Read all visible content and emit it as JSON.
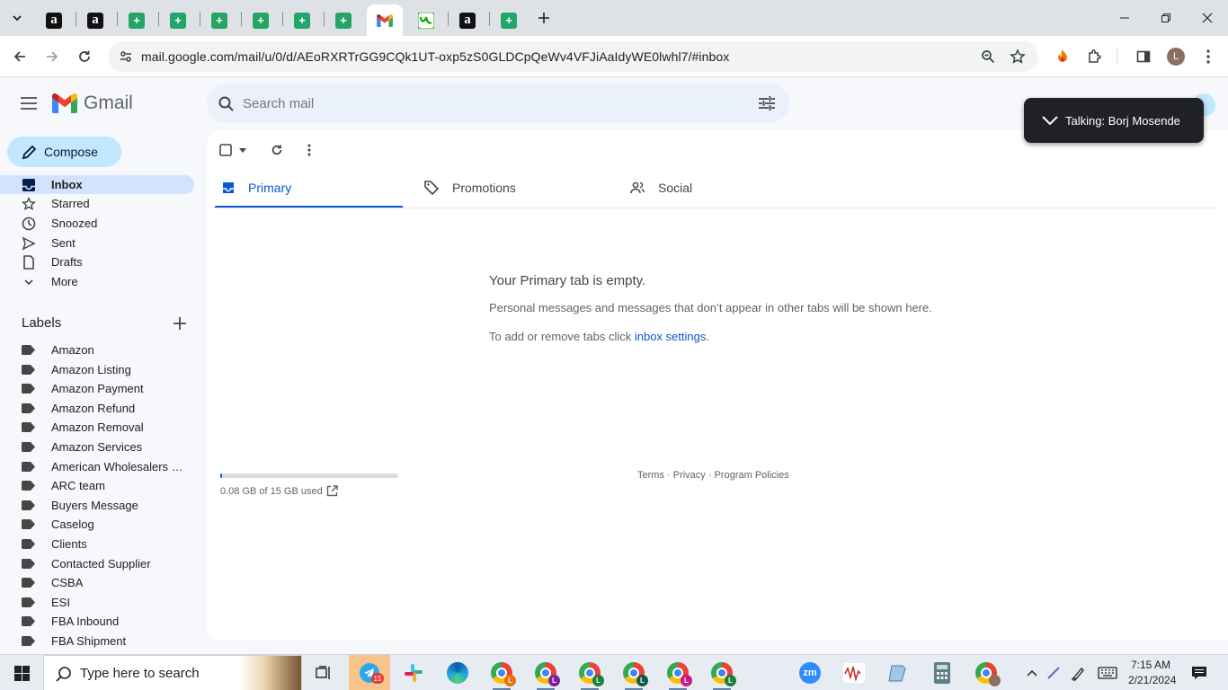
{
  "browser": {
    "tabs": [
      {
        "icon": "amazon-favicon",
        "glyph": "a"
      },
      {
        "icon": "amazon-favicon",
        "glyph": "a"
      },
      {
        "icon": "sheets-favicon",
        "glyph": "+"
      },
      {
        "icon": "sheets-favicon",
        "glyph": "+"
      },
      {
        "icon": "sheets-favicon",
        "glyph": "+"
      },
      {
        "icon": "sheets-favicon",
        "glyph": "+"
      },
      {
        "icon": "sheets-favicon",
        "glyph": "+"
      },
      {
        "icon": "sheets-favicon",
        "glyph": "+"
      },
      {
        "icon": "gmail-favicon",
        "glyph": ""
      },
      {
        "icon": "upwork-favicon",
        "glyph": ""
      },
      {
        "icon": "amazon-favicon",
        "glyph": "a"
      },
      {
        "icon": "sheets-favicon",
        "glyph": "+"
      }
    ],
    "active_tab_index": 8,
    "url": "mail.google.com/mail/u/0/d/AEoRXRTrGG9CQk1UT-oxp5zS0GLDCpQeWv4VFJiAaIdyWE0lwhl7/#inbox",
    "profile_initial": "L"
  },
  "gmail": {
    "logo_text": "Gmail",
    "search_placeholder": "Search mail",
    "compose_label": "Compose",
    "nav": [
      {
        "label": "Inbox",
        "icon": "inbox-icon",
        "active": true
      },
      {
        "label": "Starred",
        "icon": "star-icon"
      },
      {
        "label": "Snoozed",
        "icon": "clock-icon"
      },
      {
        "label": "Sent",
        "icon": "send-icon"
      },
      {
        "label": "Drafts",
        "icon": "draft-icon"
      },
      {
        "label": "More",
        "icon": "chevron-down-icon"
      }
    ],
    "labels_heading": "Labels",
    "labels": [
      "Amazon",
      "Amazon Listing",
      "Amazon Payment",
      "Amazon Refund",
      "Amazon Removal",
      "Amazon Services",
      "American Wholesalers L...",
      "ARC team",
      "Buyers Message",
      "Caselog",
      "Clients",
      "Contacted Supplier",
      "CSBA",
      "ESI",
      "FBA Inbound",
      "FBA Shipment"
    ],
    "tabs": [
      {
        "label": "Primary",
        "icon": "inbox-icon",
        "active": true
      },
      {
        "label": "Promotions",
        "icon": "tag-icon"
      },
      {
        "label": "Social",
        "icon": "people-icon"
      }
    ],
    "empty": {
      "title": "Your Primary tab is empty.",
      "description": "Personal messages and messages that don’t appear in other tabs will be shown here.",
      "settings_prefix": "To add or remove tabs click ",
      "settings_link": "inbox settings",
      "settings_suffix": "."
    },
    "storage": {
      "text": "0.08 GB of 15 GB used",
      "fraction": 0.005
    },
    "footer": {
      "terms": "Terms",
      "privacy": "Privacy",
      "policies": "Program Policies",
      "separator": " · "
    },
    "toast": {
      "text": "Talking: Borj Mosende"
    },
    "colors": {
      "accent": "#0b57d0",
      "compose_bg": "#c2e7ff",
      "active_nav": "#d3e3fd"
    }
  },
  "taskbar": {
    "search_placeholder": "Type here to search",
    "telegram_badge": "15",
    "chrome_profiles": [
      {
        "initial": "L",
        "color": "#e8710a"
      },
      {
        "initial": "L",
        "color": "#7b1fa2"
      },
      {
        "initial": "L",
        "color": "#188038"
      },
      {
        "initial": "L",
        "color": "#0f5a4c"
      },
      {
        "initial": "L",
        "color": "#d01884"
      },
      {
        "initial": "L",
        "color": "#188038"
      }
    ],
    "zoom_label": "zm",
    "time": "7:15 AM",
    "date": "2/21/2024"
  }
}
